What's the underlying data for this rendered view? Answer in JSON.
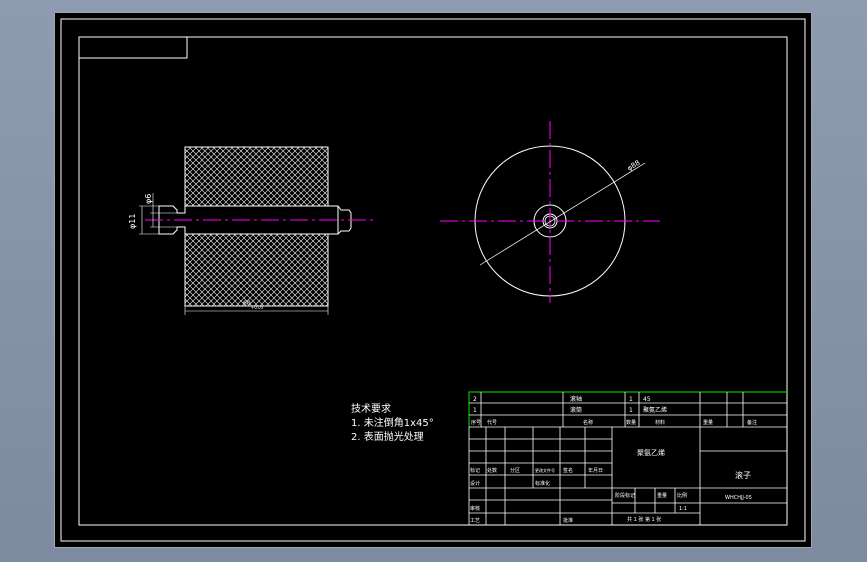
{
  "drawing": {
    "colors": {
      "background": "#000000",
      "line": "#ffffff",
      "centerline": "#ff00ff",
      "titleblock_accent": "#00c000"
    },
    "dimensions": {
      "shaft_diameter": "φ11",
      "bore_diameter": "φ6",
      "roller_length_main": "60",
      "roller_length_sub": "+0.05",
      "outer_diameter": "φ88"
    },
    "technical_notes": {
      "heading": "技术要求",
      "line1": "1. 未注倒角1x45°",
      "line2": "2. 表面抛光处理"
    },
    "title_block": {
      "part_rows": [
        {
          "seq": "2",
          "name": "滚轴",
          "qty": "1",
          "material": "45"
        },
        {
          "seq": "1",
          "name": "滚筒",
          "qty": "1",
          "material": "聚氨乙烯"
        }
      ],
      "header": {
        "seq": "序号",
        "code": "代号",
        "name": "名称",
        "qty": "数量",
        "material": "材料",
        "weight": "重量",
        "note": "备注"
      },
      "material_main": "聚氨乙烯",
      "part_title": "滚子",
      "drawing_number": "WHCHJJ-05",
      "labels": {
        "mark": "标记",
        "count": "处数",
        "zone": "分区",
        "change_doc": "更改文件号",
        "sign": "签名",
        "date": "年月日",
        "design": "设计",
        "standardize": "标准化",
        "stage": "阶段标记",
        "weight": "重量",
        "scale": "比例",
        "check": "审核",
        "craft": "工艺",
        "approve": "批准"
      },
      "scale_value": "1:1",
      "sheet_info": "共 1 张  第 1 张"
    }
  }
}
